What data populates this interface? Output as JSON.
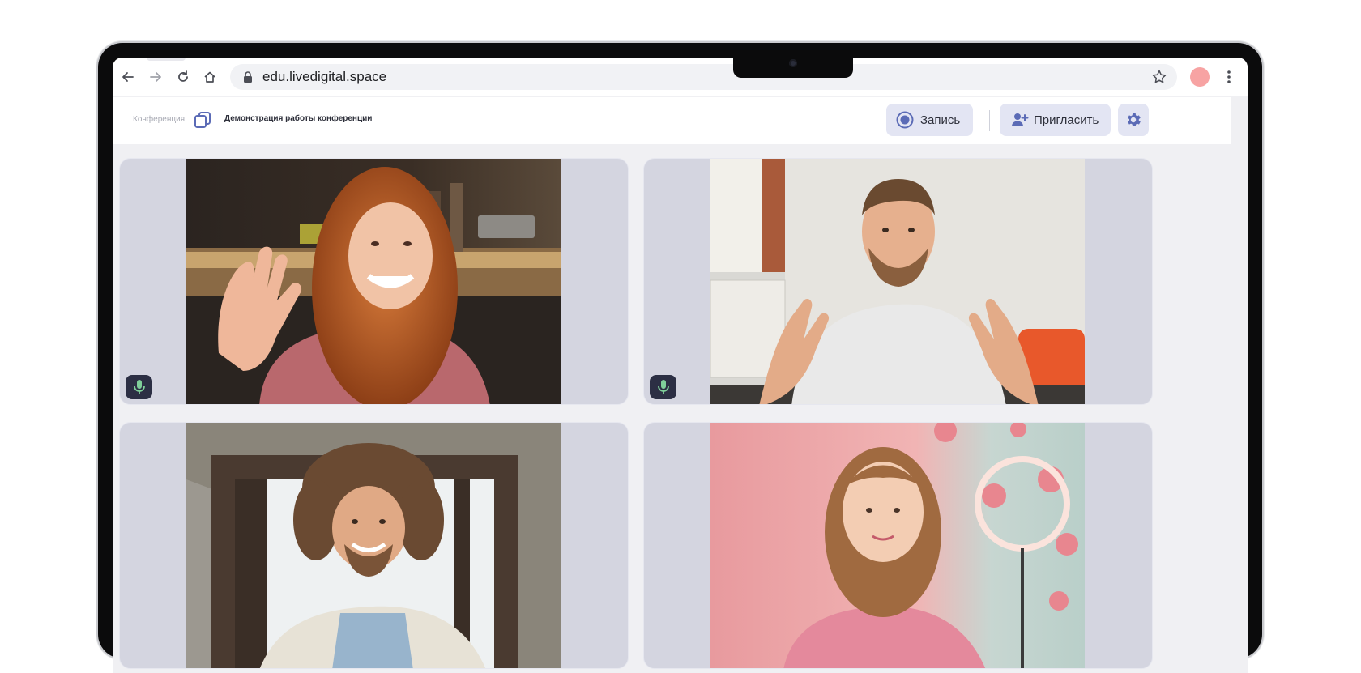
{
  "browser": {
    "url": "edu.livedigital.space",
    "back_icon": "back-arrow-icon",
    "forward_icon": "forward-arrow-icon",
    "reload_icon": "reload-icon",
    "home_icon": "home-icon",
    "lock_icon": "lock-icon",
    "bookmark_icon": "star-icon",
    "menu_icon": "kebab-menu-icon"
  },
  "header": {
    "breadcrumb": "Конференция",
    "title": "Демонстрация работы конференции",
    "record_label": "Запись",
    "invite_label": "Пригласить"
  },
  "colors": {
    "accent": "#5b6bb6",
    "button_bg": "#e3e5f3",
    "tile_bg": "#d4d5e0",
    "mic_bg": "#2c2f44",
    "mic_icon": "#7fcf9a",
    "profile_avatar": "#f7a3a3"
  },
  "participants": [
    {
      "tile": "woman-curly-red-hair-waving",
      "mic_on": true
    },
    {
      "tile": "man-beard-white-tshirt",
      "mic_on": true
    },
    {
      "tile": "man-curly-hair-smiling",
      "mic_on": false
    },
    {
      "tile": "woman-pink-sweater-ring-light",
      "mic_on": false
    }
  ]
}
